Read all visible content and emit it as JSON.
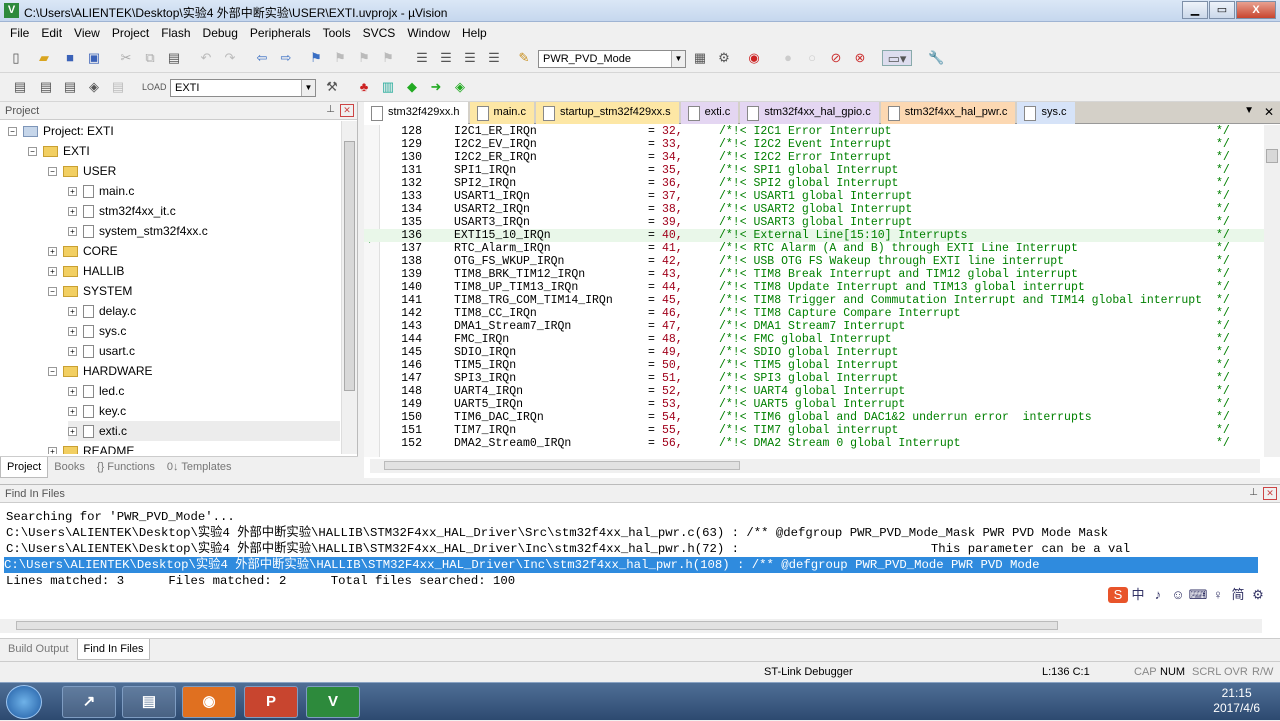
{
  "window": {
    "title": "C:\\Users\\ALIENTEK\\Desktop\\实验4 外部中断实验\\USER\\EXTI.uvprojx - µVision",
    "min": "▁",
    "max": "▭",
    "close": "X"
  },
  "menu": [
    "File",
    "Edit",
    "View",
    "Project",
    "Flash",
    "Debug",
    "Peripherals",
    "Tools",
    "SVCS",
    "Window",
    "Help"
  ],
  "toolbar": {
    "find_combo": "PWR_PVD_Mode",
    "target_combo": "EXTI"
  },
  "project": {
    "header": "Project",
    "tree": [
      {
        "label": "Project: EXTI",
        "level": 0,
        "type": "root"
      },
      {
        "label": "EXTI",
        "level": 1,
        "type": "folder"
      },
      {
        "label": "USER",
        "level": 2,
        "type": "folder"
      },
      {
        "label": "main.c",
        "level": 3,
        "type": "file"
      },
      {
        "label": "stm32f4xx_it.c",
        "level": 3,
        "type": "file"
      },
      {
        "label": "system_stm32f4xx.c",
        "level": 3,
        "type": "file"
      },
      {
        "label": "CORE",
        "level": 2,
        "type": "folder"
      },
      {
        "label": "HALLIB",
        "level": 2,
        "type": "folder"
      },
      {
        "label": "SYSTEM",
        "level": 2,
        "type": "folder"
      },
      {
        "label": "delay.c",
        "level": 3,
        "type": "file"
      },
      {
        "label": "sys.c",
        "level": 3,
        "type": "file"
      },
      {
        "label": "usart.c",
        "level": 3,
        "type": "file"
      },
      {
        "label": "HARDWARE",
        "level": 2,
        "type": "folder"
      },
      {
        "label": "led.c",
        "level": 3,
        "type": "file"
      },
      {
        "label": "key.c",
        "level": 3,
        "type": "file"
      },
      {
        "label": "exti.c",
        "level": 3,
        "type": "file"
      },
      {
        "label": "README",
        "level": 2,
        "type": "folder"
      }
    ],
    "tabs": [
      "Project",
      "Books",
      "{} Functions",
      "0↓ Templates"
    ]
  },
  "editor": {
    "tabs": [
      {
        "label": "stm32f429xx.h",
        "style": "act"
      },
      {
        "label": "main.c",
        "style": "yel"
      },
      {
        "label": "startup_stm32f429xx.s",
        "style": "yel"
      },
      {
        "label": "exti.c",
        "style": "pur"
      },
      {
        "label": "stm32f4xx_hal_gpio.c",
        "style": "pur"
      },
      {
        "label": "stm32f4xx_hal_pwr.c",
        "style": "org"
      },
      {
        "label": "sys.c",
        "style": "blu"
      }
    ],
    "lines": [
      {
        "n": "128",
        "name": "I2C1_ER_IRQn",
        "val": "32,",
        "c": "/*!< I2C1 Error Interrupt"
      },
      {
        "n": "129",
        "name": "I2C2_EV_IRQn",
        "val": "33,",
        "c": "/*!< I2C2 Event Interrupt"
      },
      {
        "n": "130",
        "name": "I2C2_ER_IRQn",
        "val": "34,",
        "c": "/*!< I2C2 Error Interrupt"
      },
      {
        "n": "131",
        "name": "SPI1_IRQn",
        "val": "35,",
        "c": "/*!< SPI1 global Interrupt"
      },
      {
        "n": "132",
        "name": "SPI2_IRQn",
        "val": "36,",
        "c": "/*!< SPI2 global Interrupt"
      },
      {
        "n": "133",
        "name": "USART1_IRQn",
        "val": "37,",
        "c": "/*!< USART1 global Interrupt"
      },
      {
        "n": "134",
        "name": "USART2_IRQn",
        "val": "38,",
        "c": "/*!< USART2 global Interrupt"
      },
      {
        "n": "135",
        "name": "USART3_IRQn",
        "val": "39,",
        "c": "/*!< USART3 global Interrupt"
      },
      {
        "n": "136",
        "name": "EXTI15_10_IRQn",
        "val": "40,",
        "c": "/*!< External Line[15:10] Interrupts",
        "cur": true
      },
      {
        "n": "137",
        "name": "RTC_Alarm_IRQn",
        "val": "41,",
        "c": "/*!< RTC Alarm (A and B) through EXTI Line Interrupt"
      },
      {
        "n": "138",
        "name": "OTG_FS_WKUP_IRQn",
        "val": "42,",
        "c": "/*!< USB OTG FS Wakeup through EXTI line interrupt"
      },
      {
        "n": "139",
        "name": "TIM8_BRK_TIM12_IRQn",
        "val": "43,",
        "c": "/*!< TIM8 Break Interrupt and TIM12 global interrupt"
      },
      {
        "n": "140",
        "name": "TIM8_UP_TIM13_IRQn",
        "val": "44,",
        "c": "/*!< TIM8 Update Interrupt and TIM13 global interrupt"
      },
      {
        "n": "141",
        "name": "TIM8_TRG_COM_TIM14_IRQn",
        "val": "45,",
        "c": "/*!< TIM8 Trigger and Commutation Interrupt and TIM14 global interrupt"
      },
      {
        "n": "142",
        "name": "TIM8_CC_IRQn",
        "val": "46,",
        "c": "/*!< TIM8 Capture Compare Interrupt"
      },
      {
        "n": "143",
        "name": "DMA1_Stream7_IRQn",
        "val": "47,",
        "c": "/*!< DMA1 Stream7 Interrupt"
      },
      {
        "n": "144",
        "name": "FMC_IRQn",
        "val": "48,",
        "c": "/*!< FMC global Interrupt"
      },
      {
        "n": "145",
        "name": "SDIO_IRQn",
        "val": "49,",
        "c": "/*!< SDIO global Interrupt"
      },
      {
        "n": "146",
        "name": "TIM5_IRQn",
        "val": "50,",
        "c": "/*!< TIM5 global Interrupt"
      },
      {
        "n": "147",
        "name": "SPI3_IRQn",
        "val": "51,",
        "c": "/*!< SPI3 global Interrupt"
      },
      {
        "n": "148",
        "name": "UART4_IRQn",
        "val": "52,",
        "c": "/*!< UART4 global Interrupt"
      },
      {
        "n": "149",
        "name": "UART5_IRQn",
        "val": "53,",
        "c": "/*!< UART5 global Interrupt"
      },
      {
        "n": "150",
        "name": "TIM6_DAC_IRQn",
        "val": "54,",
        "c": "/*!< TIM6 global and DAC1&2 underrun error  interrupts"
      },
      {
        "n": "151",
        "name": "TIM7_IRQn",
        "val": "55,",
        "c": "/*!< TIM7 global interrupt"
      },
      {
        "n": "152",
        "name": "DMA2_Stream0_IRQn",
        "val": "56,",
        "c": "/*!< DMA2 Stream 0 global Interrupt"
      }
    ],
    "eq": "=",
    "cend": "*/"
  },
  "find": {
    "header": "Find In Files",
    "lines": [
      "Searching for 'PWR_PVD_Mode'...",
      "C:\\Users\\ALIENTEK\\Desktop\\实验4 外部中断实验\\HALLIB\\STM32F4xx_HAL_Driver\\Src\\stm32f4xx_hal_pwr.c(63) : /** @defgroup PWR_PVD_Mode_Mask PWR PVD Mode Mask",
      "C:\\Users\\ALIENTEK\\Desktop\\实验4 外部中断实验\\HALLIB\\STM32F4xx_HAL_Driver\\Inc\\stm32f4xx_hal_pwr.h(72) :                          This parameter can be a val",
      "C:\\Users\\ALIENTEK\\Desktop\\实验4 外部中断实验\\HALLIB\\STM32F4xx_HAL_Driver\\Inc\\stm32f4xx_hal_pwr.h(108) : /** @defgroup PWR_PVD_Mode PWR PVD Mode",
      "Lines matched: 3      Files matched: 2      Total files searched: 100"
    ],
    "selected_index": 3,
    "ime": [
      "S",
      "中",
      "♪",
      "☺",
      "⌨",
      "♀",
      "简",
      "⚙"
    ]
  },
  "bottom_tabs": [
    "Build Output",
    "Find In Files"
  ],
  "status": {
    "debugger": "ST-Link Debugger",
    "pos": "L:136 C:1",
    "caps": "CAP",
    "num": "NUM",
    "scrl": "SCRL",
    "ovr": "OVR",
    "rw": "R/W"
  },
  "taskbar": {
    "time": "21:15",
    "date": "2017/4/6",
    "apps": [
      "↗",
      "▤",
      "◉",
      "P",
      "V"
    ]
  }
}
